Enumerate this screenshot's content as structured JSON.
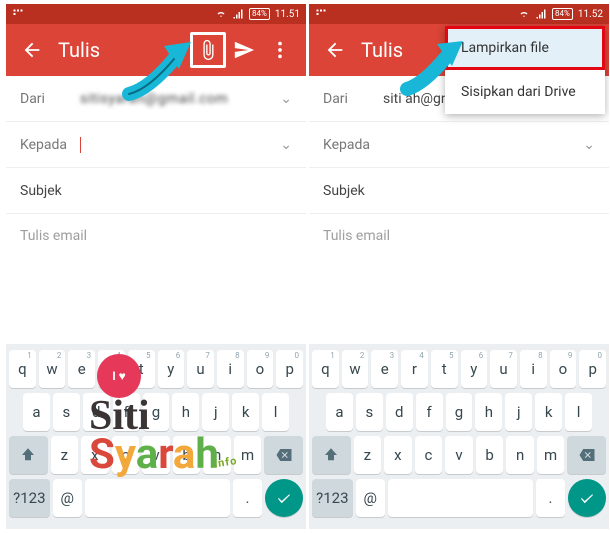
{
  "status": {
    "battery": "84%",
    "time_left": "11.51",
    "time_right": "11.52"
  },
  "toolbar": {
    "title": "Tulis"
  },
  "compose": {
    "from_label": "Dari",
    "from_value_left": "sitisyarah@gmail.com",
    "from_value_right": "siti   ah@gn",
    "to_label": "Kepada",
    "subject_placeholder": "Subjek",
    "body_placeholder": "Tulis email"
  },
  "menu": {
    "attach_file": "Lampirkan file",
    "insert_drive": "Sisipkan dari Drive"
  },
  "keyboard": {
    "row1": [
      "q",
      "w",
      "e",
      "r",
      "t",
      "y",
      "u",
      "i",
      "o",
      "p"
    ],
    "nums": [
      "1",
      "2",
      "3",
      "4",
      "5",
      "6",
      "7",
      "8",
      "9",
      "0"
    ],
    "row2": [
      "a",
      "s",
      "d",
      "f",
      "g",
      "h",
      "j",
      "k",
      "l"
    ],
    "row3": [
      "z",
      "x",
      "c",
      "v",
      "b",
      "n",
      "m"
    ],
    "sym": "?123",
    "at": "@",
    "dot": "."
  },
  "watermark": {
    "line1": "Siti",
    "line2": "Syarah",
    "tag": ".info",
    "heart": "I ♥"
  }
}
